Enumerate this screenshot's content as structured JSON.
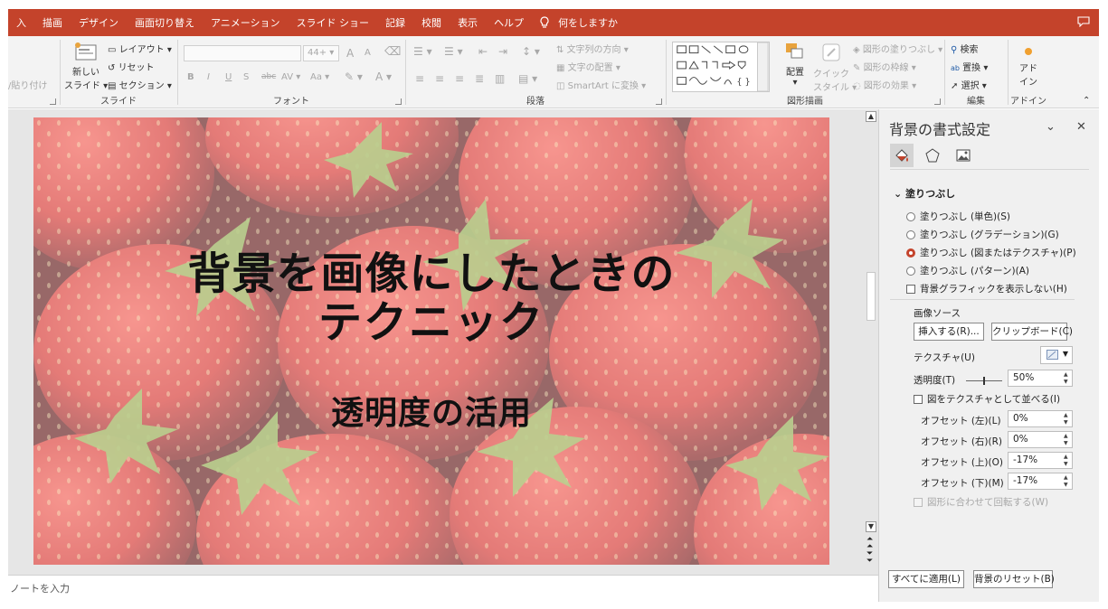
{
  "menu": {
    "tabs": [
      "入",
      "描画",
      "デザイン",
      "画面切り替え",
      "アニメーション",
      "スライド ショー",
      "記録",
      "校閲",
      "表示",
      "ヘルプ"
    ],
    "tell_me": "何をしますか",
    "accent": "#c4432b"
  },
  "ribbon": {
    "clipboard": {
      "paste_label": "/貼り付け"
    },
    "slides": {
      "new_slide_l1": "新しい",
      "new_slide_l2": "スライド",
      "layout": "レイアウト",
      "reset": "リセット",
      "section": "セクション",
      "group_label": "スライド"
    },
    "font": {
      "size": "44+",
      "bold": "B",
      "italic": "I",
      "underline": "U",
      "shadow": "S",
      "strike": "abc",
      "spacing": "AV",
      "case": "Aa",
      "grow": "A",
      "shrink": "A",
      "group_label": "フォント"
    },
    "paragraph": {
      "text_direction": "文字列の方向",
      "align_text": "文字の配置",
      "smartart": "SmartArt に変換",
      "group_label": "段落"
    },
    "drawing": {
      "arrange": "配置",
      "quick_style_l1": "クイック",
      "quick_style_l2": "スタイル",
      "shape_fill": "図形の塗りつぶし",
      "shape_outline": "図形の枠線",
      "shape_effects": "図形の効果",
      "group_label": "図形描画"
    },
    "editing": {
      "find": "検索",
      "replace": "置換",
      "select": "選択",
      "group_label": "編集"
    },
    "addins": {
      "label_l1": "アド",
      "label_l2": "イン",
      "group_label": "アドイン"
    }
  },
  "slide": {
    "title_line1": "背景を画像にしたときの",
    "title_line2": "テクニック",
    "subtitle": "透明度の活用"
  },
  "notes": {
    "placeholder": "ノートを入力"
  },
  "pane": {
    "title": "背景の書式設定",
    "tabs": [
      "fill-icon",
      "pentagon-icon",
      "picture-icon"
    ],
    "fill_section": "塗りつぶし",
    "options": [
      {
        "label": "塗りつぶし (単色)(S)",
        "selected": false
      },
      {
        "label": "塗りつぶし (グラデーション)(G)",
        "selected": false
      },
      {
        "label": "塗りつぶし (図またはテクスチャ)(P)",
        "selected": true
      },
      {
        "label": "塗りつぶし (パターン)(A)",
        "selected": false
      }
    ],
    "hide_bg_graphics": "背景グラフィックを表示しない(H)",
    "image_source": "画像ソース",
    "insert_btn": "挿入する(R)...",
    "clipboard_btn": "クリップボード(C)",
    "texture": "テクスチャ(U)",
    "transparency_label": "透明度(T)",
    "transparency_value": "50%",
    "transparency_level": 0.5,
    "tile": "図をテクスチャとして並べる(I)",
    "offsets": [
      {
        "label": "オフセット (左)(L)",
        "value": "0%"
      },
      {
        "label": "オフセット (右)(R)",
        "value": "0%"
      },
      {
        "label": "オフセット (上)(O)",
        "value": "-17%"
      },
      {
        "label": "オフセット (下)(M)",
        "value": "-17%"
      }
    ],
    "rotate_with_shape": "図形に合わせて回転する(W)",
    "apply_all": "すべてに適用(L)",
    "reset_bg": "背景のリセット(B)"
  }
}
